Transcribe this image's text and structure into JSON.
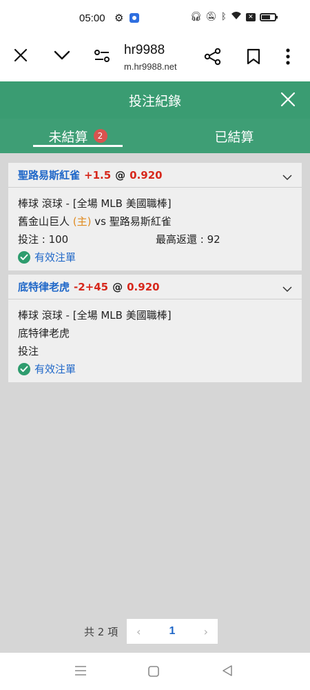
{
  "status_bar": {
    "time": "05:00",
    "icons": [
      "gear-icon",
      "app-notification-icon",
      "headphones-icon",
      "mute-icon",
      "bluetooth-icon",
      "wifi-icon",
      "close-box-icon",
      "battery-icon"
    ]
  },
  "browser": {
    "title": "hr9988",
    "url": "m.hr9988.net",
    "icons": [
      "close-icon",
      "chevron-down-icon",
      "tune-icon",
      "share-icon",
      "bookmark-icon",
      "more-icon"
    ]
  },
  "modal": {
    "title": "投注紀錄"
  },
  "tabs": [
    {
      "label": "未結算",
      "badge": "2",
      "active": true
    },
    {
      "label": "已結算",
      "active": false
    }
  ],
  "bets": [
    {
      "team": "聖路易斯紅雀",
      "line": "+1.5",
      "at": "@",
      "odds": "0.920",
      "market": "棒球 滾球 - [全場 MLB 美國職棒]",
      "home_team": "舊金山巨人",
      "home_tag": "(主)",
      "vs": "vs",
      "away_team": "聖路易斯紅雀",
      "stake": "投注 : 100",
      "max_return": "最高返還 : 92",
      "status": "有效注單"
    },
    {
      "team": "底特律老虎",
      "line": "-2+45",
      "at": "@",
      "odds": "0.920",
      "market": "棒球 滾球 - [全場 MLB 美國職棒]",
      "matchup": "底特律老虎",
      "stake": "投注",
      "status": "有效注單"
    }
  ],
  "pagination": {
    "total": "共 2 項",
    "prev": "‹",
    "current": "1",
    "next": "›"
  },
  "colors": {
    "header_green": "#3a9c72",
    "link_blue": "#1f67c8",
    "odds_red": "#d7281c",
    "home_orange": "#e08a1e",
    "badge_red": "#d9534f"
  }
}
